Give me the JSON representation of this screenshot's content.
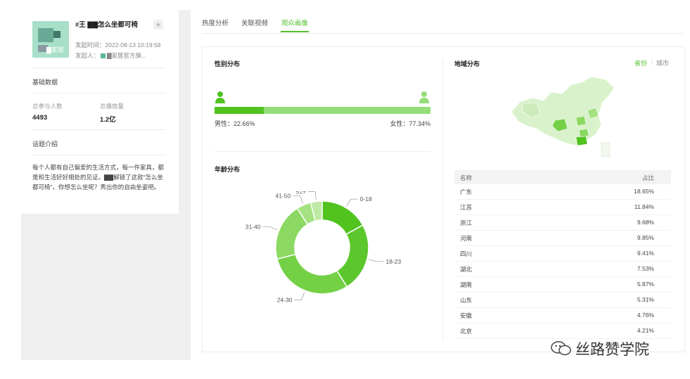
{
  "topic": {
    "title": "#王 ▇▇怎么坐都可椅",
    "thumb_text": "▇家居",
    "star": "★",
    "time_label": "发起时间：",
    "time_value": "2022-08-13 10:19:58",
    "initiator_label": "发起人：",
    "initiator_value": "▇家居官方旗..."
  },
  "basic": {
    "section_title": "基础数据",
    "participants_label": "总参与人数",
    "participants_value": "4493",
    "plays_label": "总播放量",
    "plays_value": "1.2亿"
  },
  "intro": {
    "section_title": "话题介绍",
    "text": "每个人都有自己偏爱的生活方式，每一件家具，都是和生活好好相处的见证。▇▇解锁了这款“怎么坐都可椅”，你想怎么坐呢？秀出你的自由坐姿吧。"
  },
  "tabs": [
    "热度分析",
    "关联视频",
    "观众画像"
  ],
  "gender": {
    "title": "性别分布",
    "male_label": "男性：22.66%",
    "female_label": "女性：77.34%",
    "male_share": 22.66,
    "colors": {
      "male": "#52c21f",
      "female": "#95dd78"
    }
  },
  "age": {
    "title": "年龄分布",
    "segments": [
      {
        "label": "0-18",
        "value": 17,
        "color": "#52c21f"
      },
      {
        "label": "18-23",
        "value": 24,
        "color": "#5bc72c"
      },
      {
        "label": "24-30",
        "value": 30,
        "color": "#74d146"
      },
      {
        "label": "31-40",
        "value": 20,
        "color": "#8bd962"
      },
      {
        "label": "41-50",
        "value": 5,
        "color": "#a4e282"
      },
      {
        "label": "51+",
        "value": 4,
        "color": "#bfeaa6"
      }
    ]
  },
  "region": {
    "title": "地域分布",
    "toggle_province": "省份",
    "toggle_city": "城市",
    "table_header": {
      "name": "名称",
      "share": "占比"
    },
    "rows": [
      {
        "name": "广东",
        "share": "18.65%"
      },
      {
        "name": "江苏",
        "share": "11.84%"
      },
      {
        "name": "浙江",
        "share": "9.68%"
      },
      {
        "name": "河南",
        "share": "9.85%"
      },
      {
        "name": "四川",
        "share": "9.41%"
      },
      {
        "name": "湖北",
        "share": "7.53%"
      },
      {
        "name": "湖南",
        "share": "5.87%"
      },
      {
        "name": "山东",
        "share": "5.31%"
      },
      {
        "name": "安徽",
        "share": "4.76%"
      },
      {
        "name": "北京",
        "share": "4.21%"
      }
    ]
  },
  "watermark": "丝路赞学院",
  "colors": {
    "accent": "#55be2d"
  }
}
